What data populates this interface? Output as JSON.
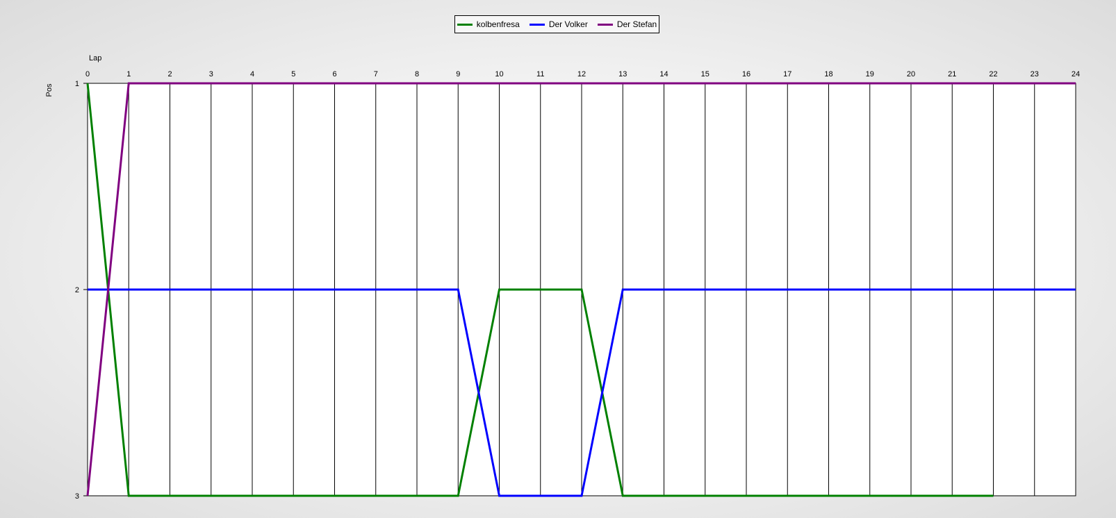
{
  "chart_data": {
    "type": "line",
    "title": "",
    "xlabel": "Lap",
    "ylabel": "Pos",
    "x": [
      0,
      1,
      2,
      3,
      4,
      5,
      6,
      7,
      8,
      9,
      10,
      11,
      12,
      13,
      14,
      15,
      16,
      17,
      18,
      19,
      20,
      21,
      22,
      23,
      24
    ],
    "xlim": [
      0,
      24
    ],
    "ylim": [
      1,
      3
    ],
    "y_inverted": true,
    "y_ticks": [
      1,
      2,
      3
    ],
    "grid": "vertical",
    "legend_position": "top-center",
    "series": [
      {
        "name": "kolbenfresa",
        "color": "#008000",
        "values": [
          1,
          3,
          3,
          3,
          3,
          3,
          3,
          3,
          3,
          3,
          2,
          2,
          2,
          3,
          3,
          3,
          3,
          3,
          3,
          3,
          3,
          3,
          3,
          null,
          null
        ]
      },
      {
        "name": "Der Volker",
        "color": "#0000ff",
        "values": [
          2,
          2,
          2,
          2,
          2,
          2,
          2,
          2,
          2,
          2,
          3,
          3,
          3,
          2,
          2,
          2,
          2,
          2,
          2,
          2,
          2,
          2,
          2,
          2,
          2
        ]
      },
      {
        "name": "Der Stefan",
        "color": "#800080",
        "values": [
          3,
          1,
          1,
          1,
          1,
          1,
          1,
          1,
          1,
          1,
          1,
          1,
          1,
          1,
          1,
          1,
          1,
          1,
          1,
          1,
          1,
          1,
          1,
          1,
          1
        ]
      }
    ]
  }
}
